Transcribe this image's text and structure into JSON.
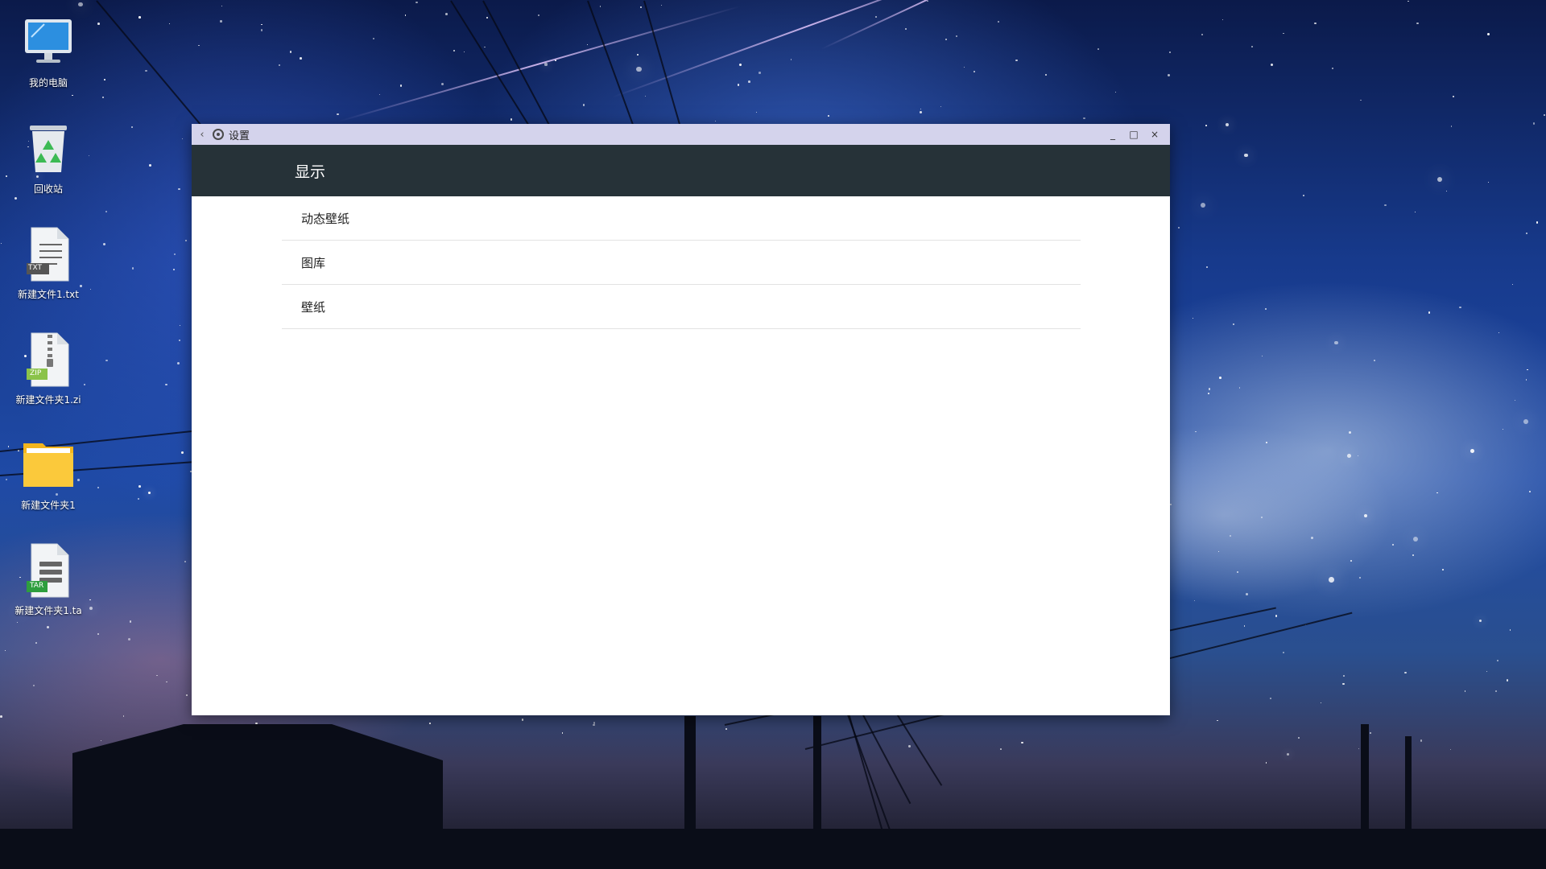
{
  "desktop": {
    "icons": [
      {
        "label": "我的电脑",
        "icon": "computer-icon"
      },
      {
        "label": "回收站",
        "icon": "recycle-bin-icon"
      },
      {
        "label": "新建文件1.txt",
        "icon": "txt-file-icon",
        "badge": "TXT"
      },
      {
        "label": "新建文件夹1.zi",
        "icon": "zip-file-icon",
        "badge": "ZIP"
      },
      {
        "label": "新建文件夹1",
        "icon": "folder-icon"
      },
      {
        "label": "新建文件夹1.ta",
        "icon": "tar-file-icon",
        "badge": "TAR"
      }
    ]
  },
  "window": {
    "title": "设置",
    "back_icon": "chevron-left-icon",
    "app_icon": "settings-gear-icon",
    "controls": {
      "minimize": "_",
      "maximize": "□",
      "close": "×"
    },
    "header": {
      "title": "显示"
    },
    "items": [
      {
        "label": "动态壁纸"
      },
      {
        "label": "图库"
      },
      {
        "label": "壁纸"
      }
    ]
  },
  "colors": {
    "titlebar": "#d4d3ec",
    "appbar": "#263238",
    "content_bg": "#ffffff",
    "divider": "#e2e2e2"
  }
}
